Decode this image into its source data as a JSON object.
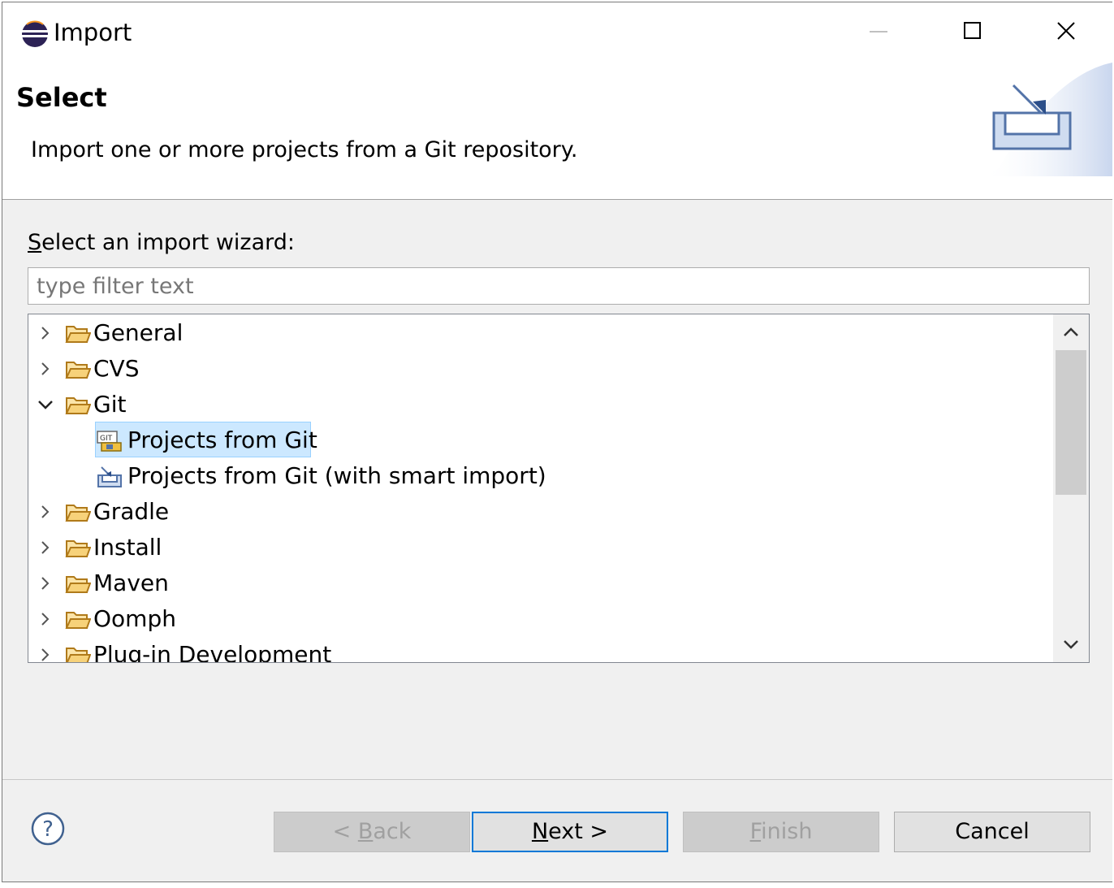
{
  "window": {
    "title": "Import"
  },
  "header": {
    "title": "Select",
    "description": "Import one or more projects from a Git repository."
  },
  "wizard": {
    "label_mnemonic": "S",
    "label_rest": "elect an import wizard:",
    "filter_placeholder": "type filter text",
    "filter_value": ""
  },
  "tree": {
    "items": [
      {
        "label": "General",
        "expanded": false,
        "icon": "folder-icon"
      },
      {
        "label": "CVS",
        "expanded": false,
        "icon": "folder-icon"
      },
      {
        "label": "Git",
        "expanded": true,
        "icon": "folder-icon",
        "children": [
          {
            "label": "Projects from Git",
            "selected": true,
            "icon": "git-import-icon"
          },
          {
            "label": "Projects from Git (with smart import)",
            "selected": false,
            "icon": "smart-import-icon"
          }
        ]
      },
      {
        "label": "Gradle",
        "expanded": false,
        "icon": "folder-icon"
      },
      {
        "label": "Install",
        "expanded": false,
        "icon": "folder-icon"
      },
      {
        "label": "Maven",
        "expanded": false,
        "icon": "folder-icon"
      },
      {
        "label": "Oomph",
        "expanded": false,
        "icon": "folder-icon"
      },
      {
        "label": "Plug-in Development",
        "expanded": false,
        "icon": "folder-icon"
      }
    ]
  },
  "buttons": {
    "back": {
      "pre": "< ",
      "mnemonic": "B",
      "rest": "ack",
      "enabled": false
    },
    "next": {
      "mnemonic": "N",
      "rest": "ext >",
      "enabled": true
    },
    "finish": {
      "mnemonic": "F",
      "rest": "inish",
      "enabled": false
    },
    "cancel": {
      "label": "Cancel",
      "enabled": true
    }
  },
  "colors": {
    "selection": "#cce8ff",
    "default_button_border": "#0078d7",
    "dialog_bg": "#f0f0f0"
  }
}
